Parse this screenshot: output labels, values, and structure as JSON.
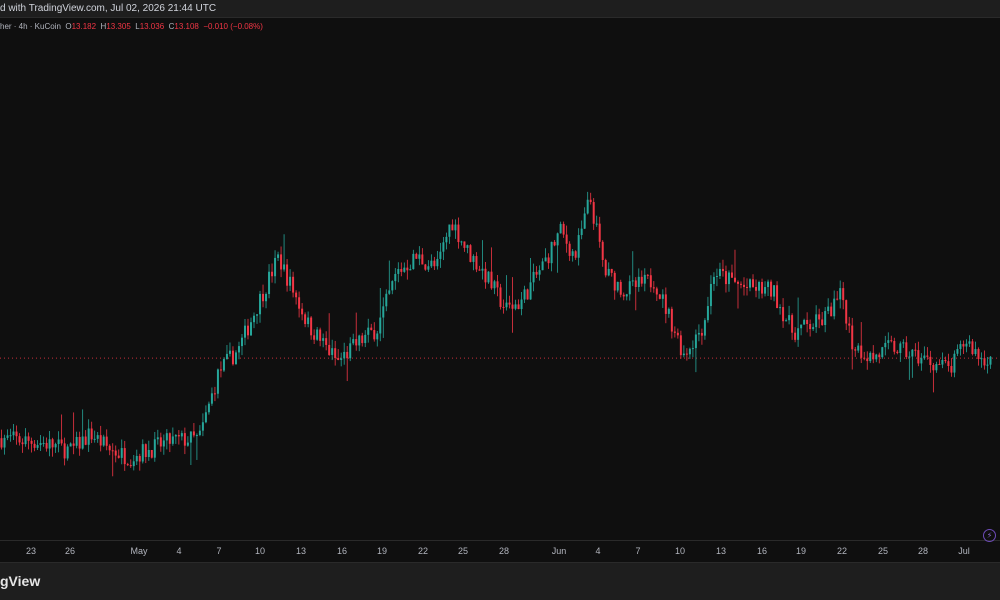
{
  "header": {
    "text": "d with TradingView.com, Jul 02, 2026 21:44 UTC"
  },
  "legend": {
    "symbol": "her · 4h · KuCoin",
    "open_label": "O",
    "open": "13.182",
    "high_label": "H",
    "high": "13.305",
    "low_label": "L",
    "low": "13.036",
    "close_label": "C",
    "close": "13.108",
    "change": "−0.010 (−0.08%)"
  },
  "footer": {
    "brand": "gView"
  },
  "icons": {
    "bolt": "lightning-icon"
  },
  "colors": {
    "up": "#26a69a",
    "down": "#f23645",
    "background": "#0f0f0f"
  },
  "chart_data": {
    "type": "candlestick",
    "interval": "4h",
    "x_ticks": [
      "23",
      "26",
      "May",
      "4",
      "7",
      "10",
      "13",
      "16",
      "19",
      "22",
      "25",
      "28",
      "Jun",
      "4",
      "7",
      "10",
      "13",
      "16",
      "19",
      "22",
      "25",
      "28",
      "Jul"
    ],
    "y_scale": "relative",
    "path_points": [
      [
        0,
        0.176
      ],
      [
        0.04,
        0.165
      ],
      [
        0.07,
        0.142
      ],
      [
        0.09,
        0.188
      ],
      [
        0.11,
        0.145
      ],
      [
        0.13,
        0.125
      ],
      [
        0.17,
        0.168
      ],
      [
        0.2,
        0.175
      ],
      [
        0.22,
        0.355
      ],
      [
        0.24,
        0.415
      ],
      [
        0.26,
        0.54
      ],
      [
        0.28,
        0.66
      ],
      [
        0.29,
        0.6
      ],
      [
        0.31,
        0.48
      ],
      [
        0.34,
        0.38
      ],
      [
        0.36,
        0.43
      ],
      [
        0.38,
        0.47
      ],
      [
        0.4,
        0.62
      ],
      [
        0.42,
        0.66
      ],
      [
        0.44,
        0.63
      ],
      [
        0.455,
        0.76
      ],
      [
        0.47,
        0.68
      ],
      [
        0.49,
        0.61
      ],
      [
        0.51,
        0.52
      ],
      [
        0.525,
        0.54
      ],
      [
        0.55,
        0.65
      ],
      [
        0.565,
        0.73
      ],
      [
        0.58,
        0.66
      ],
      [
        0.595,
        0.82
      ],
      [
        0.61,
        0.62
      ],
      [
        0.63,
        0.57
      ],
      [
        0.66,
        0.6
      ],
      [
        0.68,
        0.47
      ],
      [
        0.69,
        0.4
      ],
      [
        0.71,
        0.48
      ],
      [
        0.72,
        0.62
      ],
      [
        0.75,
        0.58
      ],
      [
        0.78,
        0.57
      ],
      [
        0.8,
        0.46
      ],
      [
        0.83,
        0.49
      ],
      [
        0.85,
        0.56
      ],
      [
        0.86,
        0.43
      ],
      [
        0.88,
        0.39
      ],
      [
        0.9,
        0.42
      ],
      [
        0.93,
        0.39
      ],
      [
        0.96,
        0.36
      ],
      [
        0.975,
        0.44
      ],
      [
        0.99,
        0.39
      ]
    ],
    "current_price_level": 0.39
  }
}
